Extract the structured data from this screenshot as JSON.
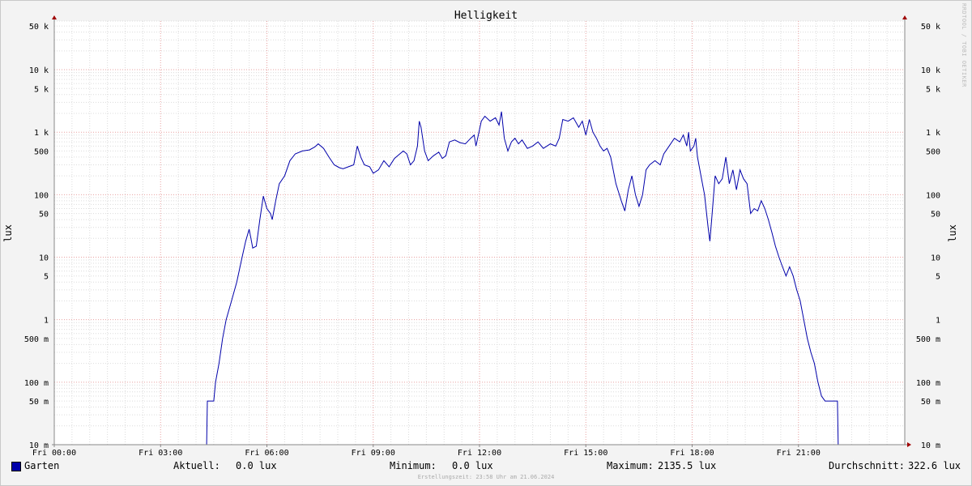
{
  "chart_data": {
    "type": "line",
    "title": "Helligkeit",
    "ylabel": "lux",
    "ylabel_right": "lux",
    "y_scale": "log",
    "ylim": [
      0.01,
      60000
    ],
    "xlim": [
      0,
      24
    ],
    "x_ticks": [
      {
        "value": 0,
        "label": "Fri 00:00"
      },
      {
        "value": 3,
        "label": "Fri 03:00"
      },
      {
        "value": 6,
        "label": "Fri 06:00"
      },
      {
        "value": 9,
        "label": "Fri 09:00"
      },
      {
        "value": 12,
        "label": "Fri 12:00"
      },
      {
        "value": 15,
        "label": "Fri 15:00"
      },
      {
        "value": 18,
        "label": "Fri 18:00"
      },
      {
        "value": 21,
        "label": "Fri 21:00"
      }
    ],
    "y_ticks": [
      {
        "value": 0.01,
        "label": "10 m"
      },
      {
        "value": 0.05,
        "label": "50 m"
      },
      {
        "value": 0.1,
        "label": "100 m"
      },
      {
        "value": 0.5,
        "label": "500 m"
      },
      {
        "value": 1,
        "label": "1"
      },
      {
        "value": 5,
        "label": "5"
      },
      {
        "value": 10,
        "label": "10"
      },
      {
        "value": 50,
        "label": "50"
      },
      {
        "value": 100,
        "label": "100"
      },
      {
        "value": 500,
        "label": "500"
      },
      {
        "value": 1000,
        "label": "1 k"
      },
      {
        "value": 5000,
        "label": "5 k"
      },
      {
        "value": 10000,
        "label": "10 k"
      },
      {
        "value": 50000,
        "label": "50 k"
      }
    ],
    "grid": true,
    "legend_position": "bottom-left",
    "series": [
      {
        "name": "Garten",
        "color": "#0000aa",
        "points": [
          [
            0,
            0.01
          ],
          [
            4.3,
            0.01
          ],
          [
            4.32,
            0.05
          ],
          [
            4.5,
            0.05
          ],
          [
            4.55,
            0.1
          ],
          [
            4.65,
            0.2
          ],
          [
            4.75,
            0.5
          ],
          [
            4.85,
            1.0
          ],
          [
            5.0,
            2.0
          ],
          [
            5.15,
            4.0
          ],
          [
            5.3,
            10
          ],
          [
            5.4,
            18
          ],
          [
            5.5,
            28
          ],
          [
            5.55,
            20
          ],
          [
            5.6,
            14
          ],
          [
            5.7,
            15
          ],
          [
            5.8,
            40
          ],
          [
            5.9,
            95
          ],
          [
            6.0,
            60
          ],
          [
            6.1,
            50
          ],
          [
            6.15,
            40
          ],
          [
            6.25,
            80
          ],
          [
            6.35,
            150
          ],
          [
            6.5,
            200
          ],
          [
            6.65,
            350
          ],
          [
            6.8,
            450
          ],
          [
            7.0,
            500
          ],
          [
            7.2,
            520
          ],
          [
            7.35,
            580
          ],
          [
            7.45,
            650
          ],
          [
            7.6,
            550
          ],
          [
            7.75,
            400
          ],
          [
            7.9,
            300
          ],
          [
            8.05,
            270
          ],
          [
            8.15,
            260
          ],
          [
            8.3,
            280
          ],
          [
            8.45,
            300
          ],
          [
            8.55,
            600
          ],
          [
            8.65,
            400
          ],
          [
            8.75,
            300
          ],
          [
            8.9,
            280
          ],
          [
            9.0,
            220
          ],
          [
            9.15,
            250
          ],
          [
            9.3,
            350
          ],
          [
            9.45,
            280
          ],
          [
            9.6,
            380
          ],
          [
            9.75,
            450
          ],
          [
            9.85,
            500
          ],
          [
            9.95,
            450
          ],
          [
            10.05,
            300
          ],
          [
            10.15,
            350
          ],
          [
            10.25,
            600
          ],
          [
            10.3,
            1500
          ],
          [
            10.35,
            1200
          ],
          [
            10.45,
            500
          ],
          [
            10.55,
            350
          ],
          [
            10.7,
            420
          ],
          [
            10.85,
            480
          ],
          [
            10.95,
            380
          ],
          [
            11.05,
            420
          ],
          [
            11.15,
            700
          ],
          [
            11.3,
            750
          ],
          [
            11.45,
            680
          ],
          [
            11.6,
            650
          ],
          [
            11.75,
            800
          ],
          [
            11.85,
            900
          ],
          [
            11.9,
            600
          ],
          [
            12.05,
            1500
          ],
          [
            12.15,
            1800
          ],
          [
            12.3,
            1500
          ],
          [
            12.45,
            1700
          ],
          [
            12.55,
            1300
          ],
          [
            12.62,
            2135
          ],
          [
            12.7,
            800
          ],
          [
            12.8,
            500
          ],
          [
            12.9,
            700
          ],
          [
            13.0,
            800
          ],
          [
            13.1,
            650
          ],
          [
            13.2,
            750
          ],
          [
            13.35,
            550
          ],
          [
            13.5,
            600
          ],
          [
            13.65,
            700
          ],
          [
            13.8,
            550
          ],
          [
            14.0,
            650
          ],
          [
            14.15,
            600
          ],
          [
            14.25,
            800
          ],
          [
            14.35,
            1600
          ],
          [
            14.5,
            1500
          ],
          [
            14.65,
            1700
          ],
          [
            14.8,
            1200
          ],
          [
            14.9,
            1500
          ],
          [
            15.0,
            900
          ],
          [
            15.1,
            1600
          ],
          [
            15.2,
            1000
          ],
          [
            15.3,
            800
          ],
          [
            15.4,
            600
          ],
          [
            15.5,
            500
          ],
          [
            15.6,
            550
          ],
          [
            15.7,
            400
          ],
          [
            15.85,
            150
          ],
          [
            16.0,
            80
          ],
          [
            16.1,
            55
          ],
          [
            16.2,
            120
          ],
          [
            16.3,
            200
          ],
          [
            16.4,
            100
          ],
          [
            16.5,
            65
          ],
          [
            16.6,
            100
          ],
          [
            16.7,
            250
          ],
          [
            16.8,
            300
          ],
          [
            16.95,
            350
          ],
          [
            17.1,
            300
          ],
          [
            17.2,
            450
          ],
          [
            17.35,
            600
          ],
          [
            17.5,
            800
          ],
          [
            17.65,
            700
          ],
          [
            17.75,
            900
          ],
          [
            17.85,
            600
          ],
          [
            17.9,
            1000
          ],
          [
            17.95,
            500
          ],
          [
            18.05,
            600
          ],
          [
            18.1,
            800
          ],
          [
            18.15,
            400
          ],
          [
            18.25,
            200
          ],
          [
            18.35,
            100
          ],
          [
            18.45,
            30
          ],
          [
            18.5,
            18
          ],
          [
            18.55,
            40
          ],
          [
            18.65,
            200
          ],
          [
            18.75,
            150
          ],
          [
            18.85,
            180
          ],
          [
            18.95,
            400
          ],
          [
            19.05,
            150
          ],
          [
            19.15,
            250
          ],
          [
            19.25,
            120
          ],
          [
            19.35,
            250
          ],
          [
            19.45,
            180
          ],
          [
            19.55,
            150
          ],
          [
            19.65,
            50
          ],
          [
            19.75,
            60
          ],
          [
            19.85,
            55
          ],
          [
            19.95,
            80
          ],
          [
            20.05,
            60
          ],
          [
            20.15,
            40
          ],
          [
            20.25,
            25
          ],
          [
            20.35,
            15
          ],
          [
            20.45,
            10
          ],
          [
            20.55,
            7
          ],
          [
            20.65,
            5
          ],
          [
            20.75,
            7
          ],
          [
            20.85,
            5
          ],
          [
            20.95,
            3
          ],
          [
            21.05,
            2
          ],
          [
            21.15,
            1.0
          ],
          [
            21.25,
            0.5
          ],
          [
            21.35,
            0.3
          ],
          [
            21.45,
            0.2
          ],
          [
            21.55,
            0.1
          ],
          [
            21.65,
            0.06
          ],
          [
            21.75,
            0.05
          ],
          [
            22.1,
            0.05
          ],
          [
            22.12,
            0.01
          ],
          [
            24.0,
            0.01
          ]
        ]
      }
    ]
  },
  "legend": {
    "series_name": "Garten",
    "current_label": "Aktuell:",
    "current_value": "0.0 lux",
    "min_label": "Minimum:",
    "min_value": "0.0 lux",
    "max_label": "Maximum:",
    "max_value": "2135.5 lux",
    "avg_label": "Durchschnitt:",
    "avg_value": "322.6 lux"
  },
  "footer": "Erstellungszeit: 23:58 Uhr am 21.06.2024",
  "watermark": "RRDTOOL / TOBI OETIKER"
}
